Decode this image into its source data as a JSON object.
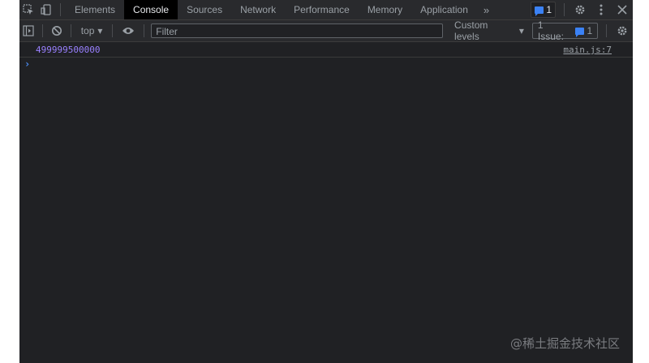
{
  "tabs": [
    {
      "label": "Elements",
      "active": false
    },
    {
      "label": "Console",
      "active": true
    },
    {
      "label": "Sources",
      "active": false
    },
    {
      "label": "Network",
      "active": false
    },
    {
      "label": "Performance",
      "active": false
    },
    {
      "label": "Memory",
      "active": false
    },
    {
      "label": "Application",
      "active": false
    }
  ],
  "tabbar": {
    "more_icon": "»",
    "message_count": "1"
  },
  "toolbar": {
    "context": "top",
    "filter_placeholder": "Filter",
    "levels": "Custom levels",
    "issues_label": "1 Issue:",
    "issues_count": "1"
  },
  "console": {
    "messages": [
      {
        "value": "499999500000",
        "source": "main.js:7"
      }
    ]
  },
  "watermark": "@稀土掘金技术社区",
  "colors": {
    "background": "#202124",
    "toolbar": "#292a2d",
    "active_tab": "#000000",
    "number_value": "#9980ff",
    "accent": "#3b82f6"
  }
}
